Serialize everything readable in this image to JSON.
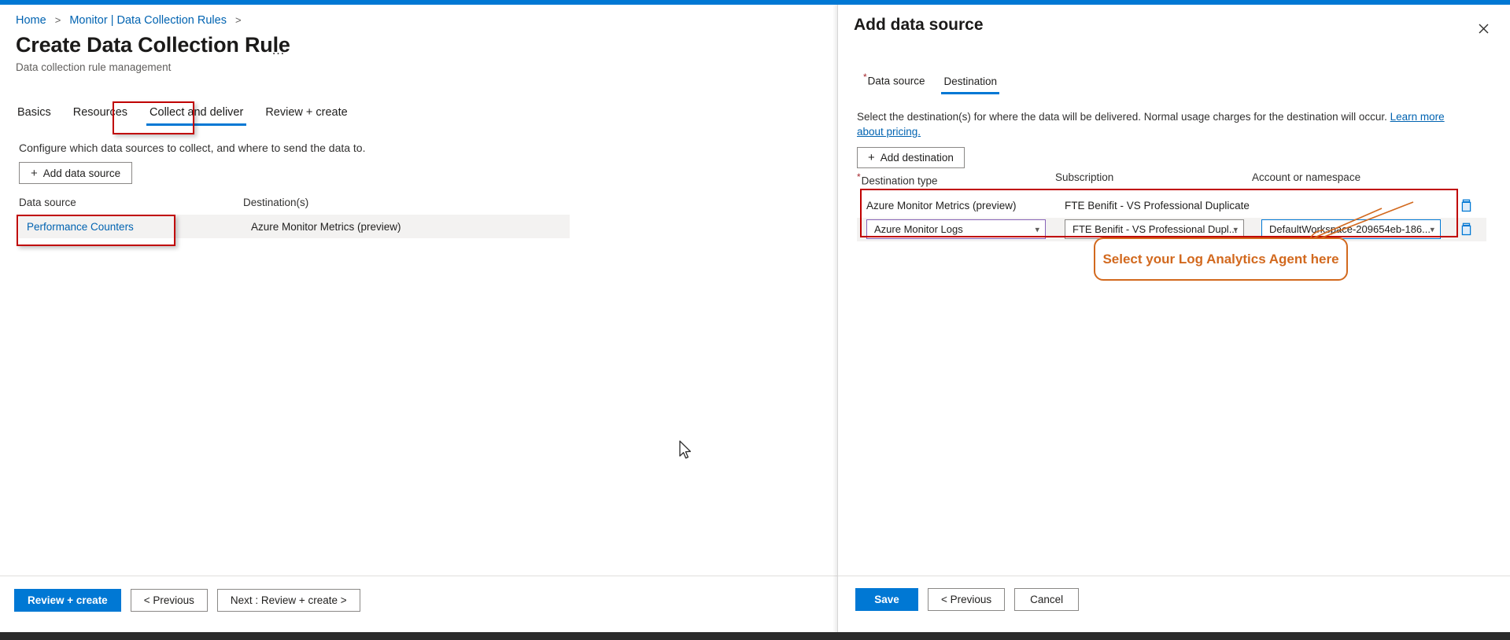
{
  "theme": {
    "accent": "#0078d4",
    "highlight_red": "#c00000",
    "annotation_orange": "#d2691e",
    "link_blue": "#0063b1",
    "row_grey": "#f3f2f1"
  },
  "left_pane": {
    "breadcrumb": {
      "items": [
        "Home",
        "Monitor | Data Collection Rules"
      ],
      "separator": ">"
    },
    "title": "Create Data Collection Rule",
    "title_more": "…",
    "subtitle": "Data collection rule management",
    "tabs": [
      {
        "label": "Basics",
        "active": false
      },
      {
        "label": "Resources",
        "active": false
      },
      {
        "label": "Collect and deliver",
        "active": true
      },
      {
        "label": "Review + create",
        "active": false
      }
    ],
    "help_text": "Configure which data sources to collect, and where to send the data to.",
    "add_data_source_button": "Add data source",
    "table": {
      "headers": [
        "Data source",
        "Destination(s)"
      ],
      "rows": [
        {
          "data_source": "Performance Counters",
          "destinations": "Azure Monitor Metrics (preview)"
        }
      ]
    },
    "footer_buttons": [
      {
        "label": "Review + create",
        "style": "primary"
      },
      {
        "label": "< Previous",
        "style": "secondary"
      },
      {
        "label": "Next : Review + create >",
        "style": "secondary"
      }
    ]
  },
  "right_pane": {
    "title": "Add data source",
    "close_icon": "close-icon",
    "tabs": [
      {
        "label": "Data source",
        "required": true,
        "active": false
      },
      {
        "label": "Destination",
        "required": false,
        "active": true
      }
    ],
    "description": {
      "text": "Select the destination(s) for where the data will be delivered. Normal usage charges for the destination will occur. ",
      "link_text": "Learn more about pricing."
    },
    "add_destination_button": "Add destination",
    "table": {
      "headers": [
        "Destination type",
        "Subscription",
        "Account or namespace"
      ],
      "header_required": [
        true,
        false,
        false
      ],
      "rows": [
        {
          "destination_type": "Azure Monitor Metrics (preview)",
          "subscription": "FTE Benifit - VS Professional Duplicate",
          "account_or_namespace": "",
          "editable": false,
          "delete_icon": "trash-icon"
        },
        {
          "destination_type": "Azure Monitor Logs",
          "subscription": "FTE Benifit - VS Professional Dupl...",
          "account_or_namespace": "DefaultWorkspace-209654eb-186...",
          "editable": true,
          "delete_icon": "trash-icon"
        }
      ]
    },
    "footer_buttons": [
      {
        "label": "Save",
        "style": "primary"
      },
      {
        "label": "< Previous",
        "style": "secondary"
      },
      {
        "label": "Cancel",
        "style": "secondary"
      }
    ]
  },
  "annotations": {
    "callout_text": "Select your Log Analytics Agent here",
    "highlight_boxes": [
      "collect-and-deliver-tab",
      "performance-counters-row",
      "destination-tab",
      "destinations-table"
    ]
  }
}
